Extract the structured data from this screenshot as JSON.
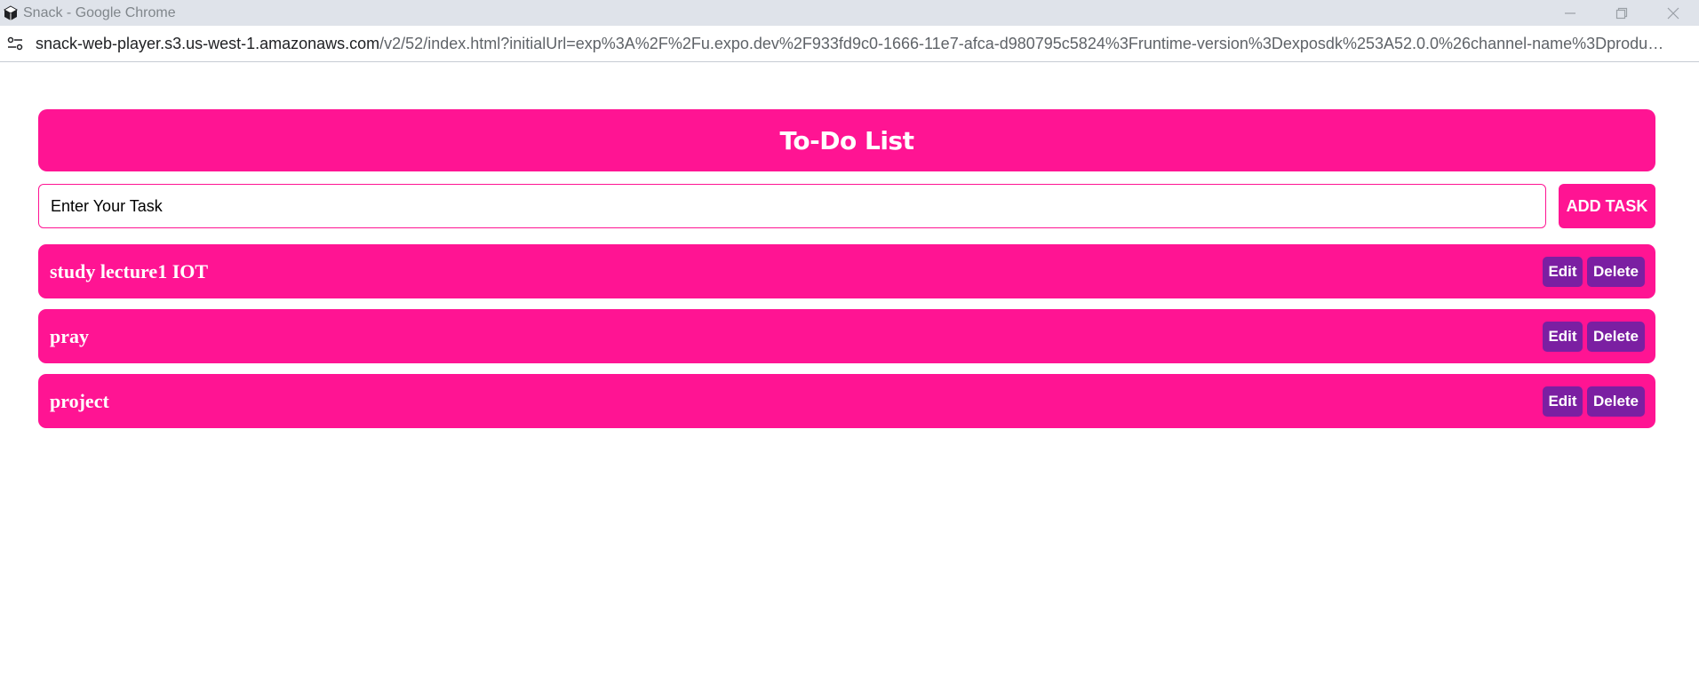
{
  "window": {
    "title": "Snack - Google Chrome",
    "app_icon": "snack-logo-icon",
    "controls": [
      "minimize-icon",
      "restore-icon",
      "close-icon"
    ]
  },
  "addressbar": {
    "site_info_icon": "site-info-icon",
    "url_host": "snack-web-player.s3.us-west-1.amazonaws.com",
    "url_path": "/v2/52/index.html?initialUrl=exp%3A%2F%2Fu.expo.dev%2F933fd9c0-1666-11e7-afca-d980795c5824%3Fruntime-version%3Dexposdk%253A52.0.0%26channel-name%3Dproduction%26sna..."
  },
  "app": {
    "header_title": "To-Do List",
    "input": {
      "placeholder": "Enter Your Task",
      "value": ""
    },
    "add_button_label": "ADD TASK",
    "tasks": [
      {
        "text": "study lecture1 IOT",
        "edit_label": "Edit",
        "delete_label": "Delete"
      },
      {
        "text": "pray",
        "edit_label": "Edit",
        "delete_label": "Delete"
      },
      {
        "text": "project",
        "edit_label": "Edit",
        "delete_label": "Delete"
      }
    ]
  },
  "colors": {
    "accent": "#ff1493",
    "action_button": "#7b1fa2",
    "titlebar": "#dfe3ea"
  }
}
